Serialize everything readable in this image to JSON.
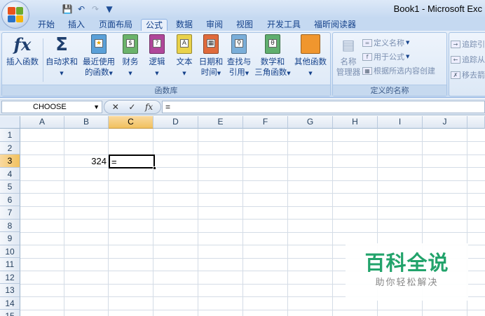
{
  "window": {
    "title": "Book1 - Microsoft Exc"
  },
  "quick_access": {
    "save_icon": "save-icon",
    "undo_icon": "undo-icon",
    "redo_icon": "redo-icon",
    "customize_icon": "customize-icon"
  },
  "tabs": [
    {
      "label": "开始"
    },
    {
      "label": "插入"
    },
    {
      "label": "页面布局"
    },
    {
      "label": "公式"
    },
    {
      "label": "数据"
    },
    {
      "label": "审阅"
    },
    {
      "label": "视图"
    },
    {
      "label": "开发工具"
    },
    {
      "label": "福昕阅读器"
    }
  ],
  "ribbon": {
    "function_library": {
      "label": "函数库",
      "insert_function": "插入函数",
      "autosum": "自动求和",
      "recent_line1": "最近使用",
      "recent_line2": "的函数",
      "financial": "财务",
      "logical": "逻辑",
      "text": "文本",
      "datetime_line1": "日期和",
      "datetime_line2": "时间",
      "lookup_line1": "查找与",
      "lookup_line2": "引用",
      "math_line1": "数学和",
      "math_line2": "三角函数",
      "more_functions": "其他函数"
    },
    "defined_names": {
      "label": "定义的名称",
      "name_manager_line1": "名称",
      "name_manager_line2": "管理器",
      "define_name": "定义名称",
      "use_in_formula": "用于公式",
      "create_from_selection": "根据所选内容创建"
    },
    "formula_auditing": {
      "trace_precedents": "追踪引",
      "trace_dependents": "追踪从",
      "remove_arrows": "移去箭"
    },
    "colors": {
      "sigma": "#1f3f6e",
      "accent": "#15428b"
    }
  },
  "formula_bar": {
    "name_box": "CHOOSE",
    "cancel": "✕",
    "enter": "✓",
    "fx": "fx",
    "content": "="
  },
  "sheet": {
    "columns": [
      "A",
      "B",
      "C",
      "D",
      "E",
      "F",
      "G",
      "H",
      "I",
      "J"
    ],
    "rows": [
      "1",
      "2",
      "3",
      "4",
      "5",
      "6",
      "7",
      "8",
      "9",
      "10",
      "11",
      "12",
      "13",
      "14",
      "15"
    ],
    "selected_column": "C",
    "selected_row": "3",
    "cells": {
      "B3": "324",
      "C3": "="
    }
  },
  "watermark": {
    "title": "百科全说",
    "subtitle": "助你轻松解决"
  }
}
